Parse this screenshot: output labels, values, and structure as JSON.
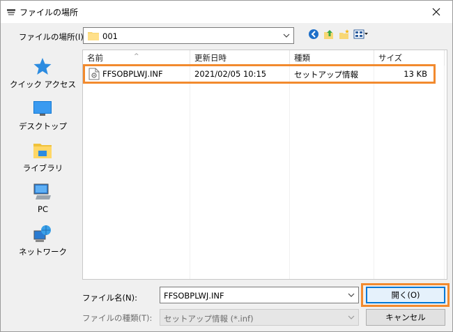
{
  "window": {
    "title": "ファイルの場所"
  },
  "lookin": {
    "label": "ファイルの場所(I):",
    "value": "001"
  },
  "places": [
    {
      "label": "クイック アクセス",
      "icon": "star-icon"
    },
    {
      "label": "デスクトップ",
      "icon": "desktop-icon"
    },
    {
      "label": "ライブラリ",
      "icon": "library-icon"
    },
    {
      "label": "PC",
      "icon": "computer-icon"
    },
    {
      "label": "ネットワーク",
      "icon": "network-icon"
    }
  ],
  "columns": [
    "名前",
    "更新日時",
    "種類",
    "サイズ"
  ],
  "files": [
    {
      "name": "FFSOBPLWJ.INF",
      "modified": "2021/02/05 10:15",
      "type": "セットアップ情報",
      "size": "13 KB"
    }
  ],
  "filename": {
    "label": "ファイル名(N):",
    "value": "FFSOBPLWJ.INF"
  },
  "filetype": {
    "label": "ファイルの種類(T):",
    "value": "セットアップ情報 (*.inf)"
  },
  "buttons": {
    "open": "開く(O)",
    "cancel": "キャンセル"
  },
  "colors": {
    "highlight": "#f28a2e",
    "accent": "#0078d7"
  }
}
